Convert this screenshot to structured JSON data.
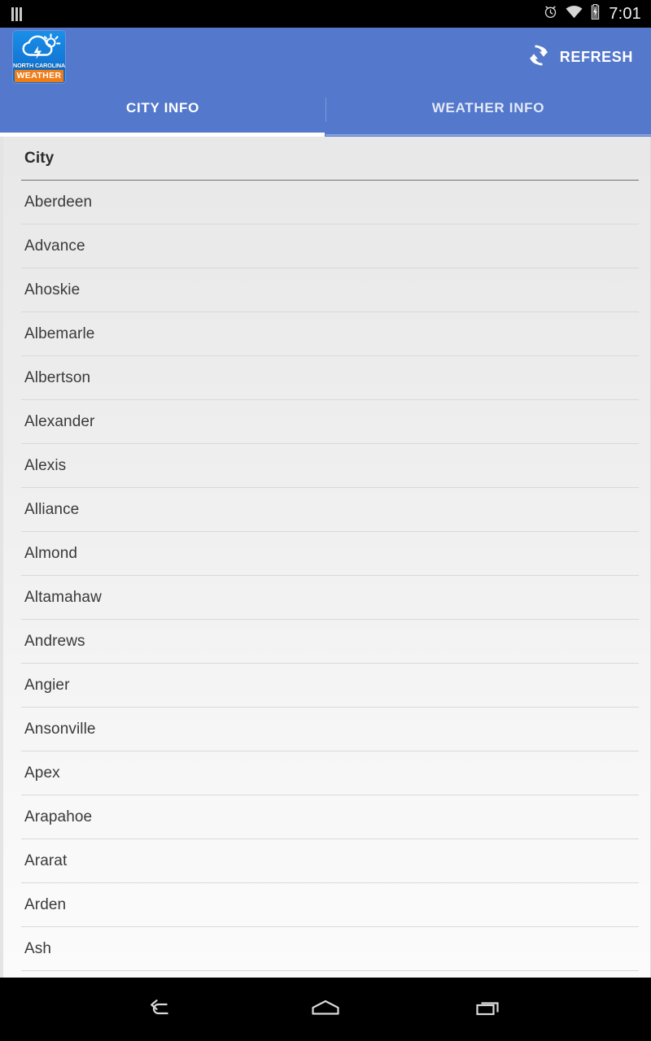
{
  "status_bar": {
    "sim_icon": "sim-bars-icon",
    "alarm_icon": "alarm-clock-icon",
    "wifi_icon": "wifi-icon",
    "battery_icon": "battery-charging-icon",
    "time": "7:01"
  },
  "app_bar": {
    "logo": {
      "icon": "cloud-sun-lightning-icon",
      "state_text": "NORTH CAROLINA",
      "band_text": "WEATHER",
      "band_color": "#f07c18",
      "background_color": "#1277d4"
    },
    "refresh": {
      "icon": "refresh-icon",
      "label": "REFRESH"
    },
    "background_color": "#5478cb"
  },
  "tabs": {
    "items": [
      {
        "label": "CITY INFO",
        "active": true
      },
      {
        "label": "WEATHER INFO",
        "active": false
      }
    ],
    "indicator_color": "#ffffff"
  },
  "city_list": {
    "header": "City",
    "rows": [
      "Aberdeen",
      "Advance",
      "Ahoskie",
      "Albemarle",
      "Albertson",
      "Alexander",
      "Alexis",
      "Alliance",
      "Almond",
      "Altamahaw",
      "Andrews",
      "Angier",
      "Ansonville",
      "Apex",
      "Arapahoe",
      "Ararat",
      "Arden",
      "Ash"
    ]
  },
  "nav_bar": {
    "back": "back-icon",
    "home": "home-icon",
    "recents": "recents-icon"
  }
}
